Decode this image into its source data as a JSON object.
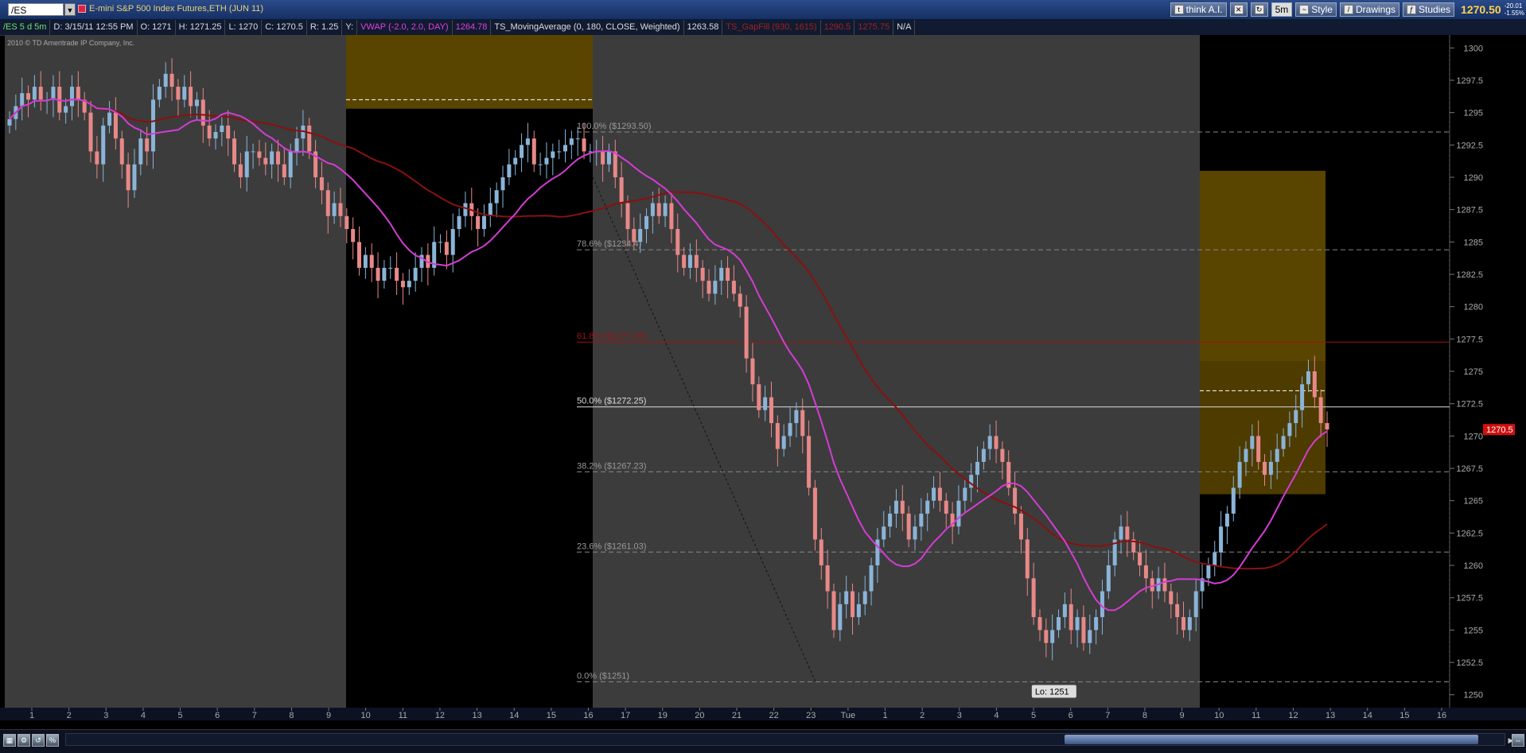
{
  "toolbar": {
    "symbol": "/ES",
    "description": "E-mini S&P 500 Index Futures,ETH (JUN 11)",
    "account": "think A.I.",
    "timeframe": "5m",
    "style_label": "Style",
    "drawings_label": "Drawings",
    "studies_label": "Studies",
    "last_price": "1270.50",
    "net_change": "-20.01",
    "pct_change": "-1.55%"
  },
  "infobar": {
    "chart_id": "/ES 5 d 5m",
    "date": "D: 3/15/11 12:55 PM",
    "open": "O: 1271",
    "high": "H: 1271.25",
    "low": "L: 1270",
    "close": "C: 1270.5",
    "range": "R: 1.25",
    "y": "Y:",
    "vwap_label": "VWAP (-2.0, 2.0, DAY)",
    "vwap_value": "1264.78",
    "ma_label": "TS_MovingAverage (0, 180, CLOSE, Weighted)",
    "ma_value": "1263.58",
    "gap_label": "TS_GapFill (930, 1615)",
    "gap_v1": "1290.5",
    "gap_v2": "1275.75",
    "na": "N/A"
  },
  "copyright": "2010 © TD Ameritrade IP Company, Inc.",
  "colors": {
    "vwap": "#d43cd4",
    "ma": "#8a1010",
    "gap_fill": "#5a4500",
    "up_candle": "#8ab4d8",
    "down_candle": "#e88888",
    "current_price": "#d01010"
  },
  "chart_data": {
    "type": "candlestick",
    "ylim": [
      1249,
      1301
    ],
    "yticks": [
      1250,
      1252.5,
      1255,
      1257.5,
      1260,
      1262.5,
      1265,
      1267.5,
      1270,
      1272.5,
      1275,
      1277.5,
      1280,
      1282.5,
      1285,
      1287.5,
      1290,
      1292.5,
      1295,
      1297.5,
      1300
    ],
    "xticks": [
      "1",
      "2",
      "3",
      "4",
      "5",
      "6",
      "7",
      "8",
      "9",
      "10",
      "11",
      "12",
      "13",
      "14",
      "15",
      "16",
      "17",
      "19",
      "20",
      "21",
      "22",
      "23",
      "Tue",
      "1",
      "2",
      "3",
      "4",
      "5",
      "6",
      "7",
      "8",
      "9",
      "10",
      "11",
      "12",
      "13",
      "14",
      "15",
      "16"
    ],
    "fib_levels": [
      {
        "label": "100.0%",
        "price_label": "($1293.50)",
        "price": 1293.5
      },
      {
        "label": "78.6%",
        "price_label": "($1284.4)",
        "price": 1284.4
      },
      {
        "label": "61.8%",
        "price_label": "($1277.26)",
        "price": 1277.26
      },
      {
        "label": "50.0%",
        "price_label": "($1272.25)",
        "price": 1272.25
      },
      {
        "label": "38.2%",
        "price_label": "($1267.23)",
        "price": 1267.23
      },
      {
        "label": "23.6%",
        "price_label": "($1261.03)",
        "price": 1261.03
      },
      {
        "label": "0.0%",
        "price_label": "($1251)",
        "price": 1251
      }
    ],
    "low_label": "Lo: 1251",
    "current_price": "1270.5",
    "closes": [
      1294.5,
      1295.5,
      1296.5,
      1296,
      1297,
      1296,
      1296,
      1297,
      1295,
      1295.5,
      1297,
      1296,
      1295,
      1292,
      1291,
      1294,
      1295,
      1293,
      1291,
      1289,
      1291,
      1293,
      1292,
      1296,
      1297,
      1298,
      1297,
      1296,
      1297,
      1295.5,
      1296,
      1294,
      1293,
      1293.5,
      1294,
      1293,
      1291,
      1290,
      1292,
      1292,
      1291.5,
      1291,
      1292,
      1291,
      1290,
      1292,
      1293,
      1294,
      1292,
      1290,
      1289,
      1287,
      1288,
      1287,
      1286,
      1285,
      1283,
      1284,
      1283,
      1282,
      1283,
      1283,
      1282,
      1281.5,
      1282,
      1283,
      1284,
      1283,
      1285,
      1285,
      1284,
      1286,
      1287,
      1288,
      1287,
      1286,
      1287,
      1288,
      1289,
      1290,
      1291,
      1291.5,
      1292.5,
      1293,
      1291,
      1291,
      1291.5,
      1292,
      1292,
      1292.5,
      1293,
      1293,
      1292,
      1292,
      1292,
      1291,
      1292,
      1290,
      1288,
      1286,
      1285,
      1286,
      1287,
      1288,
      1287,
      1288,
      1286,
      1284,
      1283,
      1284,
      1283,
      1282,
      1281,
      1282,
      1283,
      1282,
      1281,
      1280,
      1276,
      1274,
      1272,
      1273,
      1271,
      1269,
      1270,
      1271,
      1272,
      1270,
      1266,
      1262,
      1260,
      1258,
      1255,
      1257,
      1258,
      1256,
      1257,
      1258,
      1260,
      1262,
      1263,
      1264,
      1265,
      1264,
      1262,
      1263,
      1264,
      1265,
      1266,
      1265,
      1264,
      1263,
      1265,
      1266,
      1267,
      1268,
      1269,
      1270,
      1269,
      1268,
      1266,
      1264,
      1262,
      1259,
      1256,
      1255,
      1254,
      1255,
      1256,
      1257,
      1255,
      1256,
      1254,
      1255,
      1256,
      1258,
      1260,
      1262,
      1263,
      1262,
      1261,
      1260,
      1259,
      1258,
      1259,
      1258,
      1257,
      1256,
      1255,
      1256,
      1258,
      1259,
      1260,
      1261,
      1263,
      1264,
      1266,
      1268,
      1269,
      1270,
      1268,
      1267,
      1268,
      1269,
      1270,
      1271,
      1272,
      1274,
      1275,
      1273,
      1271,
      1270.5
    ]
  }
}
